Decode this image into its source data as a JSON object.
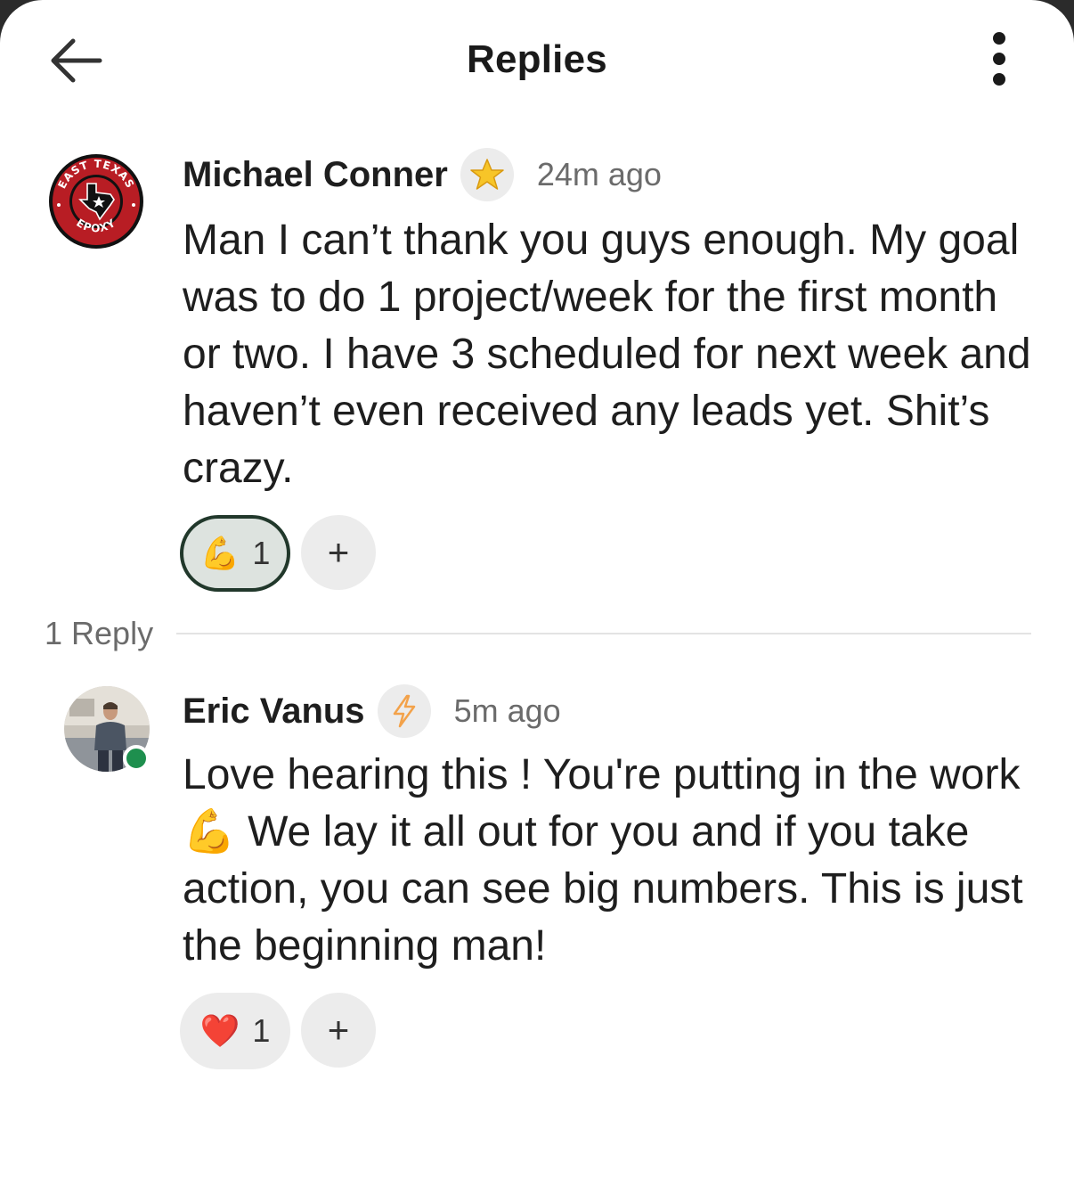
{
  "header": {
    "title": "Replies",
    "back_icon": "arrow-left-icon",
    "more_icon": "more-vertical-icon"
  },
  "comment": {
    "author": "Michael Conner",
    "badge_icon": "star-icon",
    "time": "24m ago",
    "body": "Man I can’t thank you guys enough. My goal was to do 1 project/week for the first month or two. I have 3 scheduled for next week and haven’t even received any leads yet. Shit’s crazy.",
    "avatar_logo_text": {
      "top": "EAST TEXAS",
      "bottom": "EPOXY"
    },
    "reactions": [
      {
        "emoji": "💪",
        "count": "1",
        "active": true
      }
    ],
    "add_reaction": "+"
  },
  "replies_label": "1 Reply",
  "reply": {
    "author": "Eric Vanus",
    "badge_icon": "lightning-icon",
    "time": "5m ago",
    "body_before_emoji": "Love hearing this ! You're putting in the work ",
    "inline_emoji": "💪",
    "body_after_emoji": " We lay it all out for you and if you take action, you can see big numbers. This is just the beginning man!",
    "online": true,
    "reactions": [
      {
        "emoji": "❤️",
        "count": "1",
        "active": false
      }
    ],
    "add_reaction": "+"
  },
  "colors": {
    "accent_dark_green": "#21382b",
    "online_green": "#1e8f4e",
    "logo_red": "#b81d24",
    "muted_text": "#6b6b6b"
  }
}
